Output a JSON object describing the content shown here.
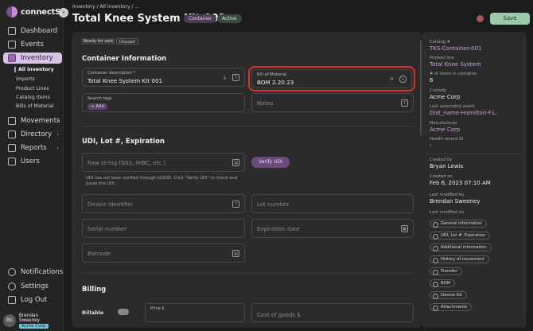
{
  "app": {
    "logo_text": "connectSx"
  },
  "sidebar": {
    "items": [
      {
        "label": "Dashboard",
        "icon": "dashboard-icon"
      },
      {
        "label": "Events",
        "icon": "calendar-icon"
      },
      {
        "label": "Inventory",
        "icon": "inventory-icon"
      },
      {
        "label": "Movements",
        "icon": "movements-icon"
      },
      {
        "label": "Directory",
        "icon": "directory-icon"
      },
      {
        "label": "Reports",
        "icon": "reports-icon"
      },
      {
        "label": "Users",
        "icon": "users-icon"
      }
    ],
    "inventory_sub": [
      "All inventory",
      "Imports",
      "Product Lines",
      "Catalog items",
      "Bills of Material"
    ],
    "bottom": [
      "Notifications",
      "Settings",
      "Log Out"
    ],
    "user": {
      "initials": "BS",
      "name": "Brendan Sweeney",
      "org": "Acme Corp"
    }
  },
  "header": {
    "breadcrumb": "Inventory / All Inventory / ...",
    "title": "Total Knee System Kit 001",
    "tags": [
      "Container",
      "Active"
    ],
    "save_label": "Save"
  },
  "main": {
    "chips": [
      "Ready for sale",
      "Unused"
    ],
    "container_section": "Container Information",
    "container_desc": {
      "label": "Container description *",
      "value": "Total Knee System Kit 001"
    },
    "bom": {
      "label": "Bill of Material",
      "value": "BOM 2.20.23"
    },
    "search_tags": {
      "label": "Search tags",
      "add_label": "+ Add"
    },
    "notes_placeholder": "Notes",
    "udi_section": "UDI, Lot #, Expiration",
    "raw_placeholder": "Raw string (GS1, HIBC, etc.)",
    "verify_label": "Verify UDI",
    "udi_note": "UDI has not been verified through GUDID. Click \"Verify UDI\" to check and parse the UDI.",
    "device_placeholder": "Device identifier",
    "lot_placeholder": "Lot number",
    "serial_placeholder": "Serial number",
    "expiration_placeholder": "Expiration date",
    "barcode_placeholder": "Barcode",
    "billing_section": "Billing",
    "billable_label": "Billable",
    "price_label": "Price $",
    "cost_placeholder": "Cost of goods $"
  },
  "details": {
    "catalog": {
      "label": "Catalog #",
      "value": "TKS-Container-001"
    },
    "product_line": {
      "label": "Product line",
      "value": "Total Knee System"
    },
    "items": {
      "label": "# of items in container",
      "value": "6"
    },
    "custody": {
      "label": "Custody",
      "value": "Acme Corp"
    },
    "last_event": {
      "label": "Last associated event",
      "value": "Dist_name-Hamilton-F.L."
    },
    "manufacturer": {
      "label": "Manufacturer",
      "value": "Acme Corp"
    },
    "health": {
      "label": "Health record ID",
      "value": "-"
    },
    "created_by": {
      "label": "Created by",
      "value": "Bryan Lewis"
    },
    "created_on": {
      "label": "Created on",
      "value": "Feb 6, 2023 07:10 AM"
    },
    "modified_by": {
      "label": "Last modified by",
      "value": "Brendan Sweeney"
    },
    "modified_on_label": "Last modified on",
    "sections": [
      "General information",
      "UDI, Lot #, Expiration",
      "Additional information",
      "History of movement",
      "Transfer",
      "BOM",
      "Device list",
      "Attachments"
    ]
  }
}
